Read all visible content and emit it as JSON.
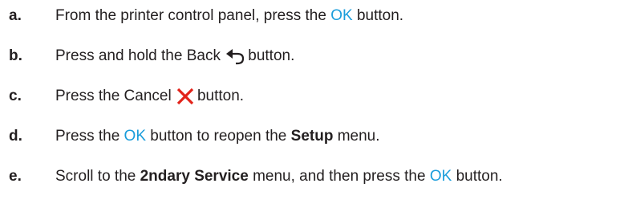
{
  "steps": [
    {
      "letter": "a.",
      "parts": [
        "From the printer control panel, press the ",
        "OK",
        " button."
      ]
    },
    {
      "letter": "b.",
      "parts": [
        "Press and hold the Back ",
        "button."
      ],
      "icon": "back-arrow-icon"
    },
    {
      "letter": "c.",
      "parts": [
        "Press the Cancel ",
        "button."
      ],
      "icon": "cancel-x-icon"
    },
    {
      "letter": "d.",
      "parts": [
        "Press the ",
        "OK",
        " button to reopen the ",
        "Setup",
        " menu."
      ]
    },
    {
      "letter": "e.",
      "parts": [
        "Scroll to the ",
        "2ndary Service",
        " menu, and then press the ",
        "OK",
        " button."
      ]
    }
  ],
  "colors": {
    "ok_accent": "#1a9ddb",
    "cancel_red": "#e2231a",
    "text": "#231f20"
  }
}
